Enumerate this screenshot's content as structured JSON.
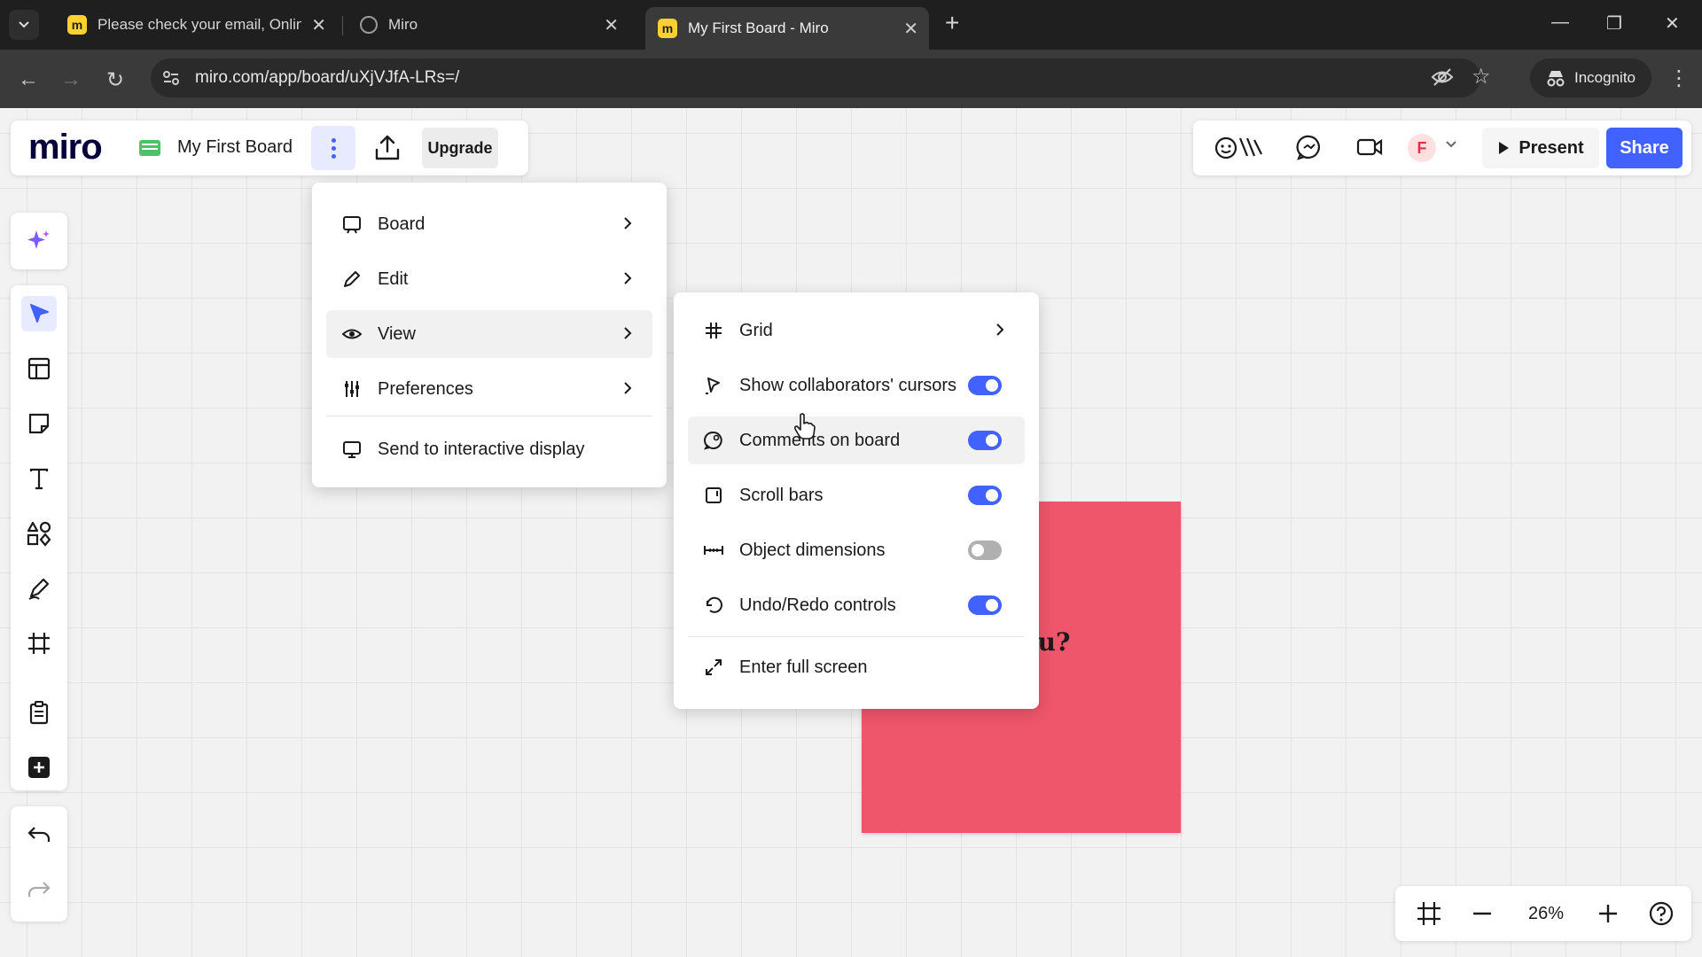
{
  "browser": {
    "tabs": [
      {
        "title": "Please check your email, Online",
        "favicon": "miro-icon"
      },
      {
        "title": "Miro",
        "favicon": "globe-icon"
      },
      {
        "title": "My First Board - Miro",
        "favicon": "miro-icon"
      }
    ],
    "url": "miro.com/app/board/uXjVJfA-LRs=/",
    "incognito_label": "Incognito"
  },
  "header": {
    "logo": "miro",
    "board_name": "My First Board",
    "upgrade_label": "Upgrade",
    "avatar_initial": "F",
    "present_label": "Present",
    "share_label": "Share"
  },
  "main_menu": {
    "items": [
      {
        "label": "Board",
        "icon": "board-icon",
        "has_submenu": true
      },
      {
        "label": "Edit",
        "icon": "edit-icon",
        "has_submenu": true
      },
      {
        "label": "View",
        "icon": "eye-icon",
        "has_submenu": true,
        "active": true
      },
      {
        "label": "Preferences",
        "icon": "sliders-icon",
        "has_submenu": true
      },
      {
        "label": "Send to interactive display",
        "icon": "display-icon",
        "has_submenu": false
      }
    ]
  },
  "view_menu": {
    "grid_label": "Grid",
    "items": [
      {
        "label": "Show collaborators' cursors",
        "icon": "cursor-icon",
        "enabled": true
      },
      {
        "label": "Comments on board",
        "icon": "comment-icon",
        "enabled": true
      },
      {
        "label": "Scroll bars",
        "icon": "scrollbar-icon",
        "enabled": true
      },
      {
        "label": "Object dimensions",
        "icon": "dimensions-icon",
        "enabled": false
      },
      {
        "label": "Undo/Redo controls",
        "icon": "undo-icon",
        "enabled": true
      }
    ],
    "fullscreen_label": "Enter full screen"
  },
  "canvas": {
    "sticky_text": "ou?",
    "sticky_color": "#f0566b"
  },
  "zoom": {
    "level": "26%"
  },
  "colors": {
    "accent": "#4262ff",
    "toggle_off": "#b0b0b0"
  }
}
